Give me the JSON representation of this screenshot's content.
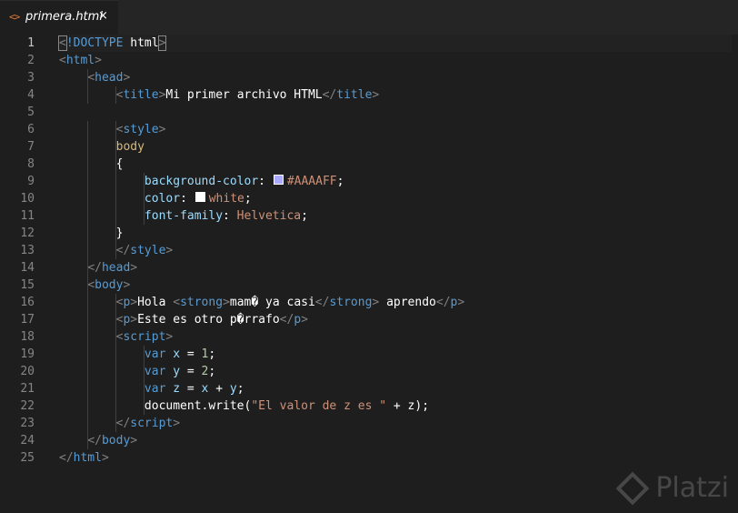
{
  "tab": {
    "icon": "<>",
    "filename": "primera.html",
    "close_glyph": "×",
    "icon_name": "html-file-icon",
    "close_icon_name": "close-icon"
  },
  "colors": {
    "background": "#1e1e1e",
    "tag": "#569cd6",
    "attribute": "#9cdcfe",
    "string": "#ce9178",
    "selector": "#d7ba7d",
    "swatch_aaaaff": "#AAAAFF",
    "swatch_white": "#FFFFFF"
  },
  "editor": {
    "line_numbers": [
      "1",
      "2",
      "3",
      "4",
      "5",
      "6",
      "7",
      "8",
      "9",
      "10",
      "11",
      "12",
      "13",
      "14",
      "15",
      "16",
      "17",
      "18",
      "19",
      "20",
      "21",
      "22",
      "23",
      "24",
      "25"
    ],
    "active_line": "1",
    "lines": [
      {
        "tokens": [
          {
            "t": "<",
            "c": "punc"
          },
          {
            "t": "!DOCTYPE",
            "c": "tag"
          },
          {
            "t": " html",
            "c": "white"
          },
          {
            "t": ">",
            "c": "punc"
          }
        ]
      },
      {
        "tokens": [
          {
            "t": "<",
            "c": "punc"
          },
          {
            "t": "html",
            "c": "tag"
          },
          {
            "t": ">",
            "c": "punc"
          }
        ]
      },
      {
        "tokens": [
          {
            "t": "    ",
            "c": "text"
          },
          {
            "t": "<",
            "c": "punc"
          },
          {
            "t": "head",
            "c": "tag"
          },
          {
            "t": ">",
            "c": "punc"
          }
        ]
      },
      {
        "tokens": [
          {
            "t": "        ",
            "c": "text"
          },
          {
            "t": "<",
            "c": "punc"
          },
          {
            "t": "title",
            "c": "tag"
          },
          {
            "t": ">",
            "c": "punc"
          },
          {
            "t": "Mi primer archivo HTML",
            "c": "white"
          },
          {
            "t": "</",
            "c": "punc"
          },
          {
            "t": "title",
            "c": "tag"
          },
          {
            "t": ">",
            "c": "punc"
          }
        ]
      },
      {
        "tokens": []
      },
      {
        "tokens": [
          {
            "t": "        ",
            "c": "text"
          },
          {
            "t": "<",
            "c": "punc"
          },
          {
            "t": "style",
            "c": "tag"
          },
          {
            "t": ">",
            "c": "punc"
          }
        ]
      },
      {
        "tokens": [
          {
            "t": "        ",
            "c": "text"
          },
          {
            "t": "body",
            "c": "sel"
          }
        ]
      },
      {
        "tokens": [
          {
            "t": "        ",
            "c": "text"
          },
          {
            "t": "{",
            "c": "white"
          }
        ]
      },
      {
        "tokens": [
          {
            "t": "            ",
            "c": "text"
          },
          {
            "t": "background-color",
            "c": "prop"
          },
          {
            "t": ": ",
            "c": "white"
          },
          {
            "t": "",
            "c": "swatch",
            "color": "#AAAAFF"
          },
          {
            "t": "#AAAAFF",
            "c": "val"
          },
          {
            "t": ";",
            "c": "white"
          }
        ]
      },
      {
        "tokens": [
          {
            "t": "            ",
            "c": "text"
          },
          {
            "t": "color",
            "c": "prop"
          },
          {
            "t": ": ",
            "c": "white"
          },
          {
            "t": "",
            "c": "swatch",
            "color": "#FFFFFF"
          },
          {
            "t": "white",
            "c": "val"
          },
          {
            "t": ";",
            "c": "white"
          }
        ]
      },
      {
        "tokens": [
          {
            "t": "            ",
            "c": "text"
          },
          {
            "t": "font-family",
            "c": "prop"
          },
          {
            "t": ": ",
            "c": "white"
          },
          {
            "t": "Helvetica",
            "c": "val"
          },
          {
            "t": ";",
            "c": "white"
          }
        ]
      },
      {
        "tokens": [
          {
            "t": "        ",
            "c": "text"
          },
          {
            "t": "}",
            "c": "white"
          }
        ]
      },
      {
        "tokens": [
          {
            "t": "        ",
            "c": "text"
          },
          {
            "t": "</",
            "c": "punc"
          },
          {
            "t": "style",
            "c": "tag"
          },
          {
            "t": ">",
            "c": "punc"
          }
        ]
      },
      {
        "tokens": [
          {
            "t": "    ",
            "c": "text"
          },
          {
            "t": "</",
            "c": "punc"
          },
          {
            "t": "head",
            "c": "tag"
          },
          {
            "t": ">",
            "c": "punc"
          }
        ]
      },
      {
        "tokens": [
          {
            "t": "    ",
            "c": "text"
          },
          {
            "t": "<",
            "c": "punc"
          },
          {
            "t": "body",
            "c": "tag"
          },
          {
            "t": ">",
            "c": "punc"
          }
        ]
      },
      {
        "tokens": [
          {
            "t": "        ",
            "c": "text"
          },
          {
            "t": "<",
            "c": "punc"
          },
          {
            "t": "p",
            "c": "tag"
          },
          {
            "t": ">",
            "c": "punc"
          },
          {
            "t": "Hola ",
            "c": "white"
          },
          {
            "t": "<",
            "c": "punc"
          },
          {
            "t": "strong",
            "c": "tag"
          },
          {
            "t": ">",
            "c": "punc"
          },
          {
            "t": "mam� ya casi",
            "c": "white"
          },
          {
            "t": "</",
            "c": "punc"
          },
          {
            "t": "strong",
            "c": "tag"
          },
          {
            "t": ">",
            "c": "punc"
          },
          {
            "t": " aprendo",
            "c": "white"
          },
          {
            "t": "</",
            "c": "punc"
          },
          {
            "t": "p",
            "c": "tag"
          },
          {
            "t": ">",
            "c": "punc"
          }
        ]
      },
      {
        "tokens": [
          {
            "t": "        ",
            "c": "text"
          },
          {
            "t": "<",
            "c": "punc"
          },
          {
            "t": "p",
            "c": "tag"
          },
          {
            "t": ">",
            "c": "punc"
          },
          {
            "t": "Este es otro p�rrafo",
            "c": "white"
          },
          {
            "t": "</",
            "c": "punc"
          },
          {
            "t": "p",
            "c": "tag"
          },
          {
            "t": ">",
            "c": "punc"
          }
        ]
      },
      {
        "tokens": [
          {
            "t": "        ",
            "c": "text"
          },
          {
            "t": "<",
            "c": "punc"
          },
          {
            "t": "script",
            "c": "tag"
          },
          {
            "t": ">",
            "c": "punc"
          }
        ]
      },
      {
        "tokens": [
          {
            "t": "            ",
            "c": "text"
          },
          {
            "t": "var",
            "c": "kw"
          },
          {
            "t": " x ",
            "c": "var"
          },
          {
            "t": "= ",
            "c": "white"
          },
          {
            "t": "1",
            "c": "num"
          },
          {
            "t": ";",
            "c": "white"
          }
        ]
      },
      {
        "tokens": [
          {
            "t": "            ",
            "c": "text"
          },
          {
            "t": "var",
            "c": "kw"
          },
          {
            "t": " y ",
            "c": "var"
          },
          {
            "t": "= ",
            "c": "white"
          },
          {
            "t": "2",
            "c": "num"
          },
          {
            "t": ";",
            "c": "white"
          }
        ]
      },
      {
        "tokens": [
          {
            "t": "            ",
            "c": "text"
          },
          {
            "t": "var",
            "c": "kw"
          },
          {
            "t": " z ",
            "c": "var"
          },
          {
            "t": "= ",
            "c": "white"
          },
          {
            "t": "x",
            "c": "var"
          },
          {
            "t": " + ",
            "c": "white"
          },
          {
            "t": "y",
            "c": "var"
          },
          {
            "t": ";",
            "c": "white"
          }
        ]
      },
      {
        "tokens": [
          {
            "t": "            ",
            "c": "text"
          },
          {
            "t": "document",
            "c": "white"
          },
          {
            "t": ".",
            "c": "white"
          },
          {
            "t": "write",
            "c": "white"
          },
          {
            "t": "(",
            "c": "white"
          },
          {
            "t": "\"El valor de z es \"",
            "c": "str"
          },
          {
            "t": " + ",
            "c": "white"
          },
          {
            "t": "z",
            "c": "white"
          },
          {
            "t": ");",
            "c": "white"
          }
        ]
      },
      {
        "tokens": [
          {
            "t": "        ",
            "c": "text"
          },
          {
            "t": "</",
            "c": "punc"
          },
          {
            "t": "script",
            "c": "tag"
          },
          {
            "t": ">",
            "c": "punc"
          }
        ]
      },
      {
        "tokens": [
          {
            "t": "    ",
            "c": "text"
          },
          {
            "t": "</",
            "c": "punc"
          },
          {
            "t": "body",
            "c": "tag"
          },
          {
            "t": ">",
            "c": "punc"
          }
        ]
      },
      {
        "tokens": [
          {
            "t": "</",
            "c": "punc"
          },
          {
            "t": "html",
            "c": "tag"
          },
          {
            "t": ">",
            "c": "punc"
          }
        ]
      }
    ]
  },
  "watermark": {
    "text": "Platzi",
    "icon_name": "platzi-logo-icon"
  }
}
